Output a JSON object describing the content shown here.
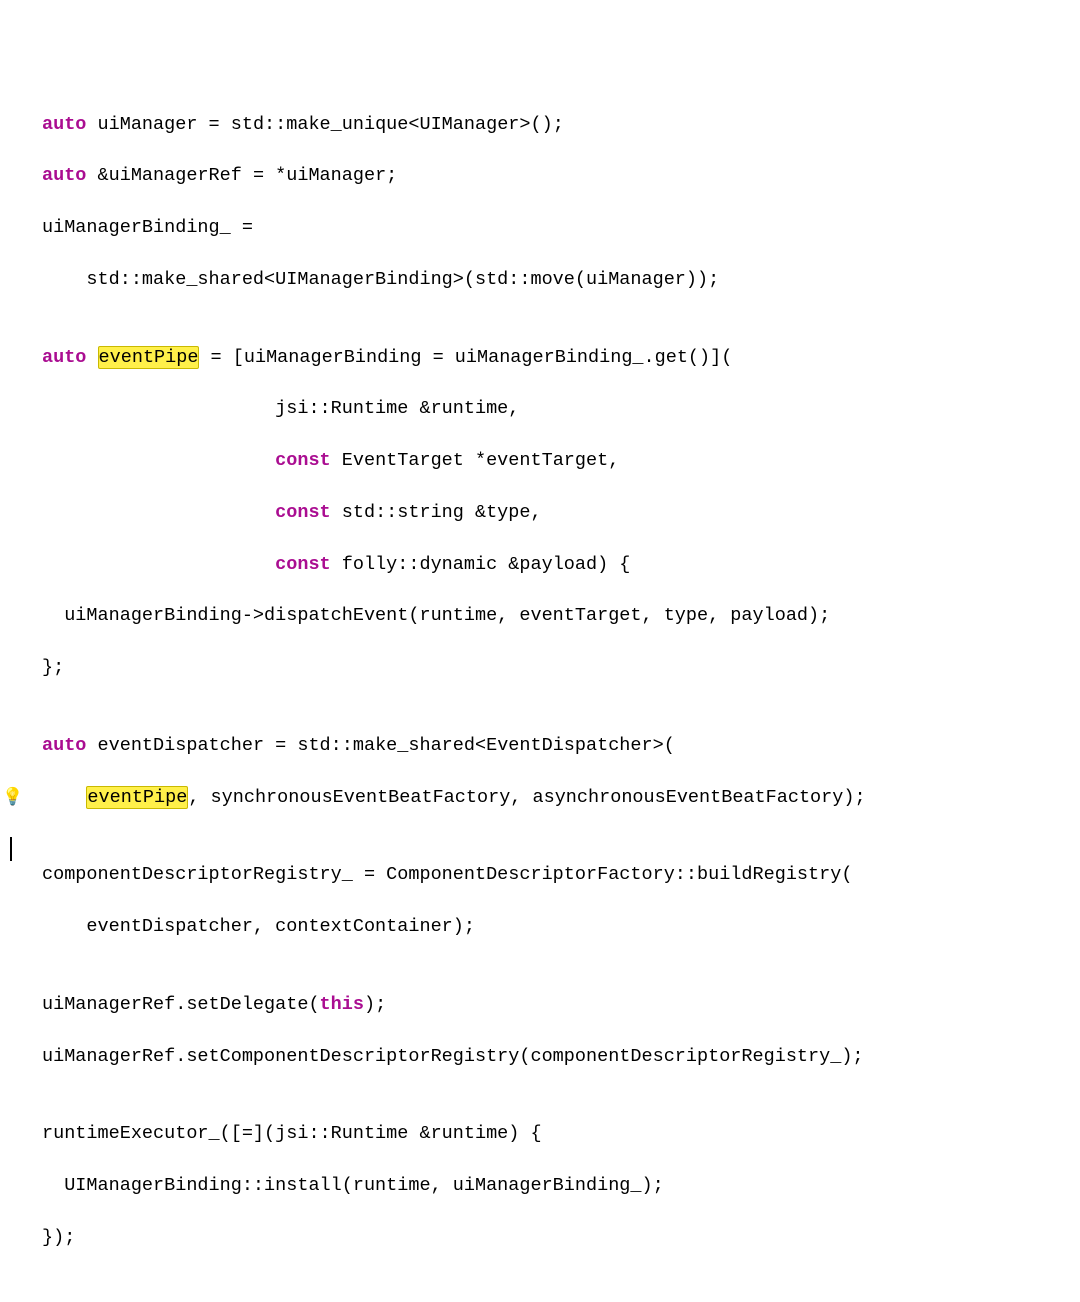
{
  "code": {
    "l01_kw": "auto",
    "l01_rest": " uiManager = std::make_unique<UIManager>();",
    "l02_kw": "auto",
    "l02_rest": " &uiManagerRef = *uiManager;",
    "l03": "uiManagerBinding_ =",
    "l04": "    std::make_shared<UIManagerBinding>(std::move(uiManager));",
    "l05": "",
    "l06_kw": "auto",
    "l06_sp": " ",
    "l06_hl": "eventPipe",
    "l06_rest": " = [uiManagerBinding = uiManagerBinding_.get()](",
    "l07": "                     jsi::Runtime &runtime,",
    "l08_pre": "                     ",
    "l08_kw": "const",
    "l08_rest": " EventTarget *eventTarget,",
    "l09_pre": "                     ",
    "l09_kw": "const",
    "l09_rest": " std::string &type,",
    "l10_pre": "                     ",
    "l10_kw": "const",
    "l10_rest": " folly::dynamic &payload) {",
    "l11": "  uiManagerBinding->dispatchEvent(runtime, eventTarget, type, payload);",
    "l12": "};",
    "l13": "",
    "l14_kw": "auto",
    "l14_rest": " eventDispatcher = std::make_shared<EventDispatcher>(",
    "l15_pre": "    ",
    "l15_hl": "eventPipe",
    "l15_rest": ", synchronousEventBeatFactory, asynchronousEventBeatFactory);",
    "l16": "",
    "l17": "componentDescriptorRegistry_ = ComponentDescriptorFactory::buildRegistry(",
    "l18": "    eventDispatcher, contextContainer);",
    "l19": "",
    "l20": "uiManagerRef.setDelegate(",
    "l20_kw": "this",
    "l20_end": ");",
    "l21": "uiManagerRef.setComponentDescriptorRegistry(componentDescriptorRegistry_);",
    "l22": "",
    "l23": "runtimeExecutor_([=](jsi::Runtime &runtime) {",
    "l24": "  UIManagerBinding::install(runtime, uiManagerBinding_);",
    "l25": "});"
  },
  "icons": {
    "bulb": "💡"
  }
}
